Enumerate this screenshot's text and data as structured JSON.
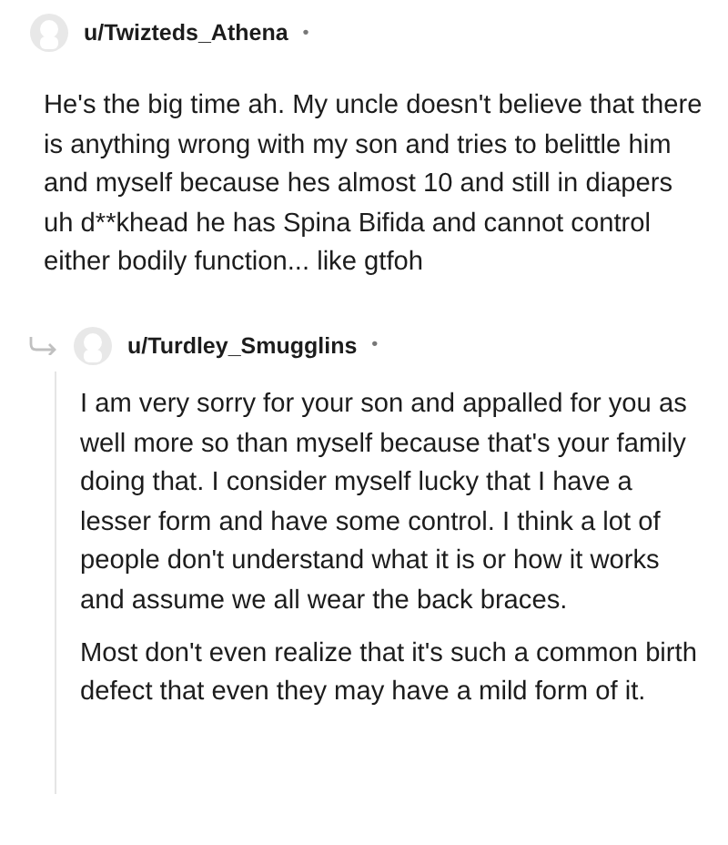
{
  "comments": [
    {
      "kind": "top",
      "author": "u/Twizteds_Athena",
      "separator": "•",
      "paragraphs": [
        "He's the big time ah. My uncle doesn't believe that there is anything wrong with my son and tries to belittle him and myself because hes almost 10 and still in diapers uh d**khead he has Spina Bifida and cannot control either bodily function... like gtfoh"
      ]
    },
    {
      "kind": "reply",
      "author": "u/Turdley_Smugglins",
      "separator": "•",
      "paragraphs": [
        "I am very sorry for your son and appalled for you as well more so than myself because that's your family doing that. I consider myself lucky that I have a lesser form and have some control. I think a lot of people don't understand what it is or how it works and assume we all wear the back braces.",
        "Most don't even realize that it's such a common birth defect that even they may have a mild form of it."
      ]
    }
  ]
}
